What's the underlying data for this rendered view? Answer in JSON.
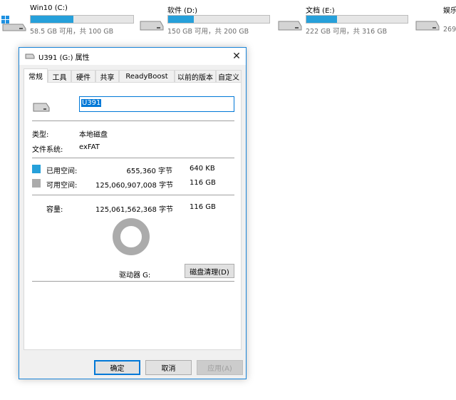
{
  "drives": [
    {
      "name": "Win10 (C:)",
      "free_text": "58.5 GB 可用，共 100 GB",
      "used_fraction": 0.415,
      "icon": "windows-drive-icon"
    },
    {
      "name": "软件 (D:)",
      "free_text": "150 GB 可用，共 200 GB",
      "used_fraction": 0.25,
      "icon": "hard-drive-icon"
    },
    {
      "name": "文档 (E:)",
      "free_text": "222 GB 可用，共 316 GB",
      "used_fraction": 0.3,
      "icon": "hard-drive-icon"
    },
    {
      "name": "娱乐",
      "free_text": "269",
      "used_fraction": 0.3,
      "icon": "hard-drive-icon"
    }
  ],
  "dialog": {
    "title": "U391 (G:) 属性",
    "tabs": [
      "常规",
      "工具",
      "硬件",
      "共享",
      "ReadyBoost",
      "以前的版本",
      "自定义"
    ],
    "active_tab": "常规",
    "volume_name": "U391",
    "type_label": "类型:",
    "type_value": "本地磁盘",
    "fs_label": "文件系统:",
    "fs_value": "exFAT",
    "used_label": "已用空间:",
    "used_bytes": "655,360 字节",
    "used_size": "640 KB",
    "free_label": "可用空间:",
    "free_bytes": "125,060,907,008 字节",
    "free_size": "116 GB",
    "capacity_label": "容量:",
    "capacity_bytes": "125,061,562,368 字节",
    "capacity_size": "116 GB",
    "drive_label": "驱动器 G:",
    "cleanup_button": "磁盘清理(D)",
    "ok_button": "确定",
    "cancel_button": "取消",
    "apply_button": "应用(A)",
    "used_color": "#26a0da",
    "free_color": "#ababab"
  }
}
